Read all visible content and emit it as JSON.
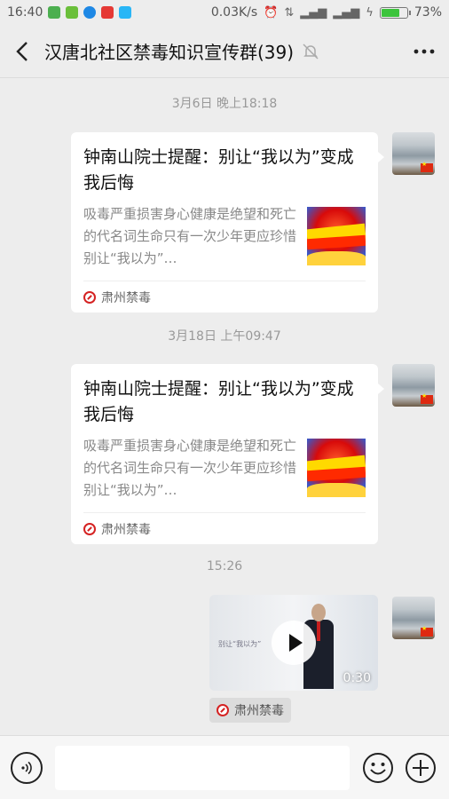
{
  "status_bar": {
    "time": "16:40",
    "network_speed": "0.03K/s",
    "battery": "73%",
    "battery_level": 0.73
  },
  "header": {
    "title": "汉唐北社区禁毒知识宣传群(39)"
  },
  "messages": [
    {
      "timestamp": "3月6日 晚上18:18",
      "card": {
        "title": "钟南山院士提醒：别让“我以为”变成我后悔",
        "description": "吸毒严重损害身心健康是绝望和死亡的代名词生命只有一次少年更应珍惜别让“我以为”…",
        "source": "肃州禁毒"
      }
    },
    {
      "timestamp": "3月18日 上午09:47",
      "card": {
        "title": "钟南山院士提醒：别让“我以为”变成我后悔",
        "description": "吸毒严重损害身心健康是绝望和死亡的代名词生命只有一次少年更应珍惜别让“我以为”…",
        "source": "肃州禁毒"
      }
    },
    {
      "timestamp": "15:26",
      "video": {
        "duration": "0:30",
        "caption": "别让“我以为”",
        "source": "肃州禁毒"
      }
    }
  ]
}
